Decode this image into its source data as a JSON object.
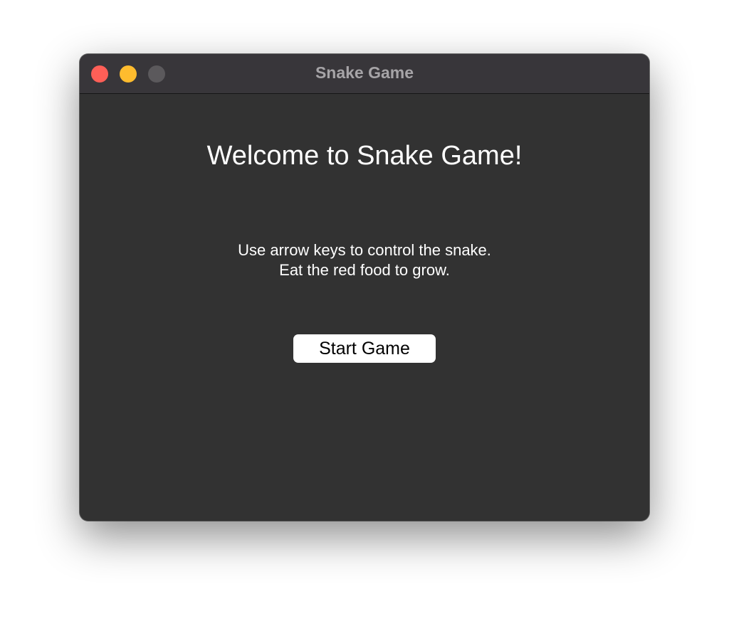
{
  "window": {
    "title": "Snake Game",
    "controls": [
      {
        "name": "close",
        "color": "#ff5f57"
      },
      {
        "name": "minimize",
        "color": "#febc2e"
      },
      {
        "name": "zoom",
        "color": "#5b595c"
      }
    ]
  },
  "main": {
    "heading": "Welcome to Snake Game!",
    "instructions": [
      "Use arrow keys to control the snake.",
      "Eat the red food to grow."
    ],
    "start_button_label": "Start Game"
  },
  "colors": {
    "window_background": "#323232",
    "titlebar_background": "#38363a",
    "text": "#ffffff",
    "button_background": "#ffffff",
    "button_text": "#000000"
  }
}
